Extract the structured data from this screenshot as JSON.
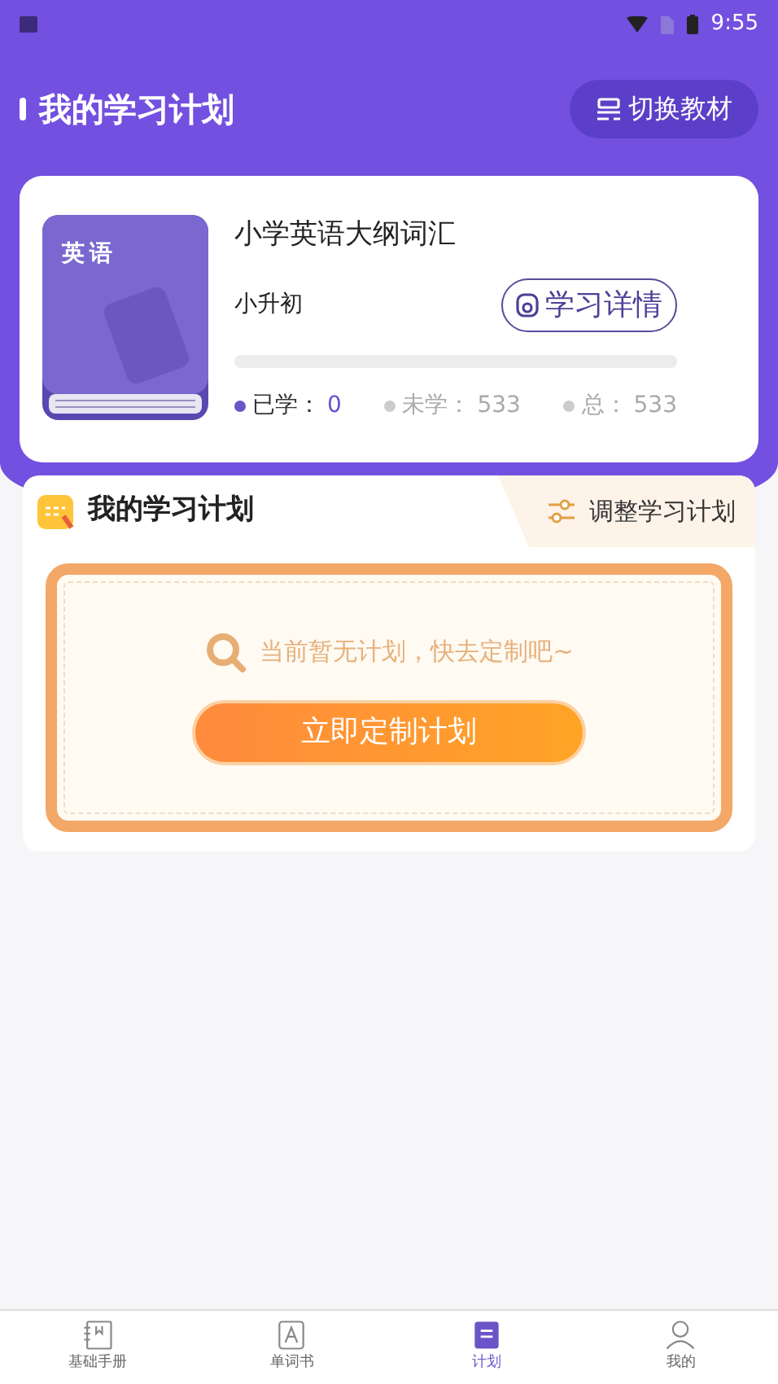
{
  "status_bar": {
    "time": "9:55"
  },
  "header": {
    "title": "我的学习计划",
    "switch_button": "切换教材"
  },
  "book": {
    "cover_label": "英语",
    "title": "小学英语大纲词汇",
    "subtitle": "小升初",
    "details_button": "学习详情",
    "progress": {
      "level": 0
    },
    "stats": [
      {
        "label": "已学：",
        "value": "0",
        "color": "#6a54c8"
      },
      {
        "label": "未学：",
        "value": "533",
        "color": "#cccccc"
      },
      {
        "label": "总：",
        "value": "533",
        "color": "#cccccc"
      }
    ]
  },
  "plan": {
    "title": "我的学习计划",
    "adjust_link": "调整学习计划",
    "empty_message": "当前暂无计划，快去定制吧~",
    "create_button": "立即定制计划"
  },
  "bottom_nav": [
    {
      "label": "基础手册",
      "kind": "manual",
      "selected": false
    },
    {
      "label": "单词书",
      "kind": "letter",
      "selected": false
    },
    {
      "label": "计划",
      "kind": "plan",
      "selected": true
    },
    {
      "label": "我的",
      "kind": "me",
      "selected": false
    }
  ]
}
